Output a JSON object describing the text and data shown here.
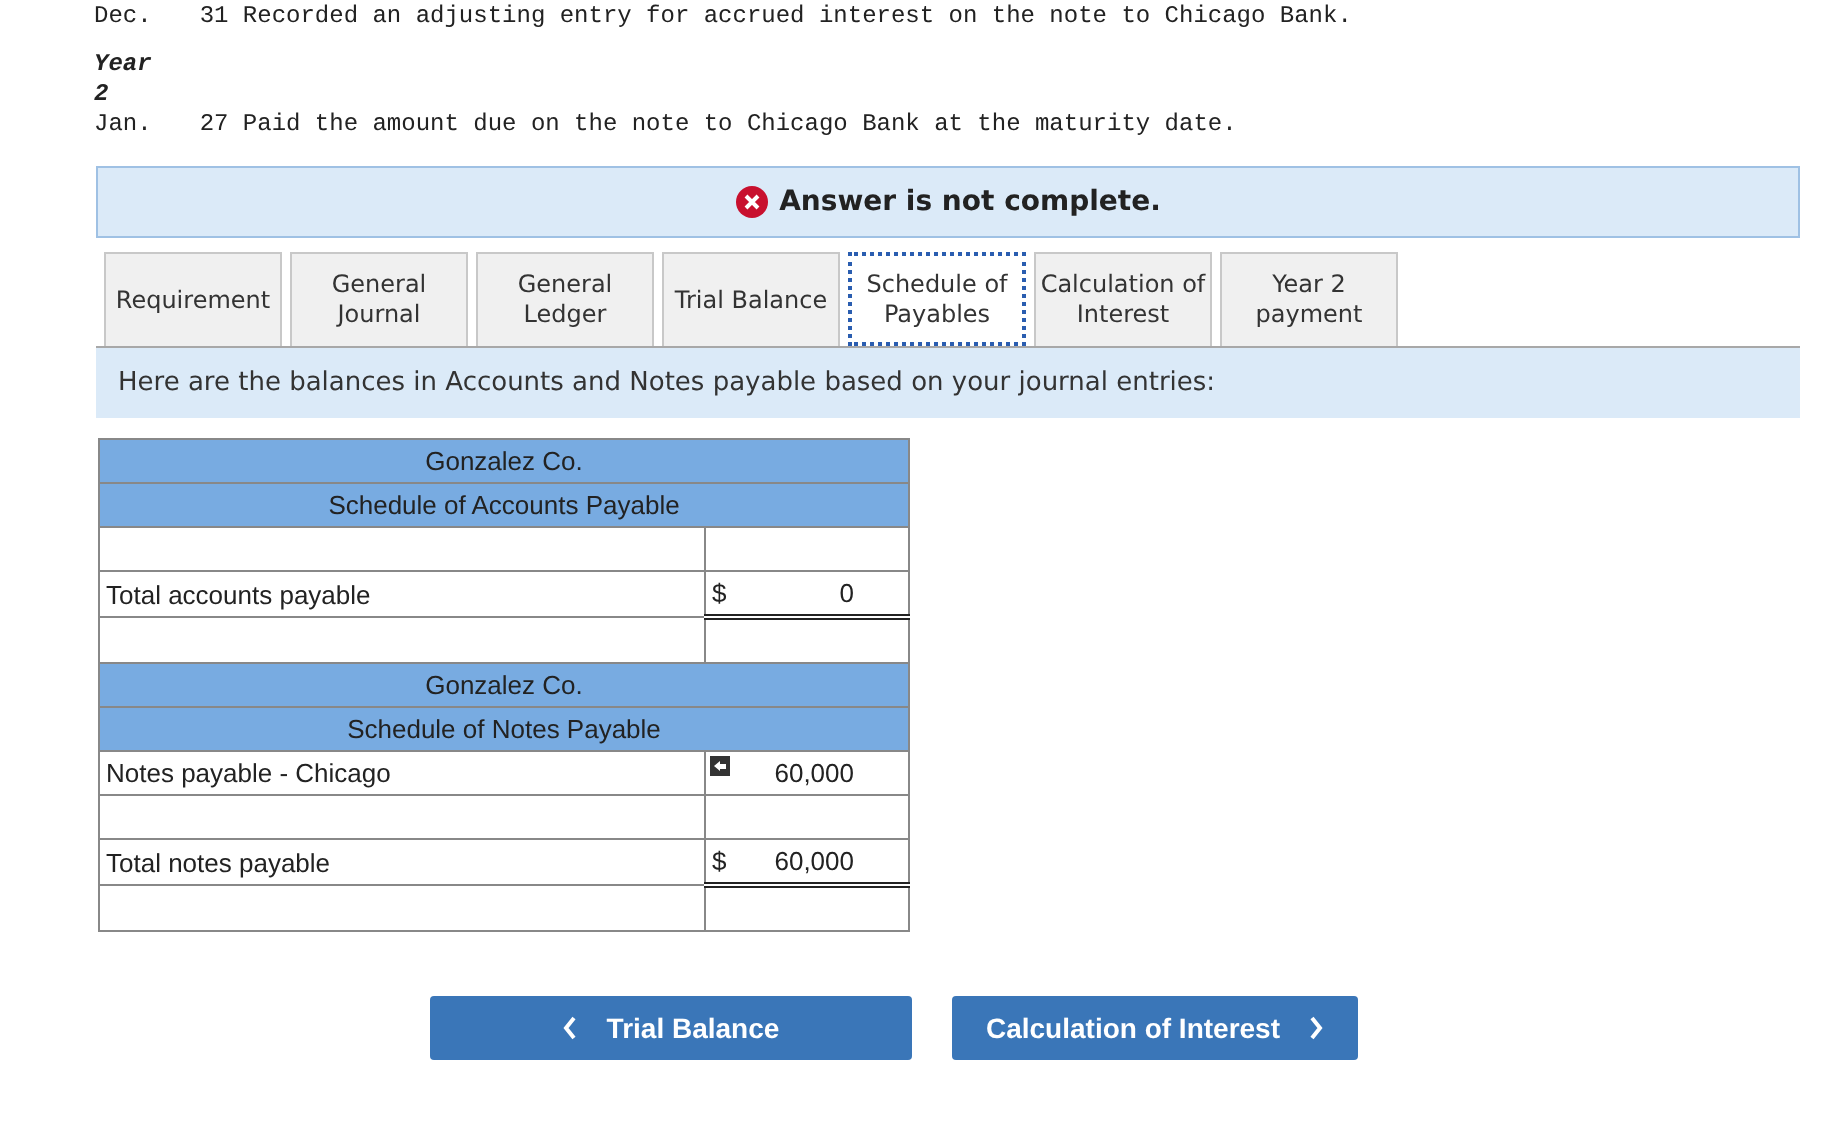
{
  "problem_lines": [
    {
      "month": "Dec.",
      "text": "31 Recorded an adjusting entry for accrued interest on the note to Chicago Bank."
    },
    {
      "year_label": "Year",
      "year_number": "2"
    },
    {
      "month": "Jan.",
      "text": "27 Paid the amount due on the note to Chicago Bank at the maturity date."
    }
  ],
  "status_banner": {
    "text": "Answer is not complete.",
    "complete": false
  },
  "tabs": [
    {
      "label": "Requirement",
      "selected": false
    },
    {
      "label": "General\nJournal",
      "selected": false
    },
    {
      "label": "General\nLedger",
      "selected": false
    },
    {
      "label": "Trial Balance",
      "selected": false
    },
    {
      "label": "Schedule of\nPayables",
      "selected": true
    },
    {
      "label": "Calculation of\nInterest",
      "selected": false
    },
    {
      "label": "Year 2\npayment",
      "selected": false
    }
  ],
  "instruction": "Here are the balances in Accounts and Notes payable based on your journal entries:",
  "schedule_rows": [
    {
      "kind": "title",
      "text": "Gonzalez Co."
    },
    {
      "kind": "title",
      "text": "Schedule of Accounts Payable"
    },
    {
      "kind": "blank"
    },
    {
      "kind": "total",
      "label": "Total accounts payable",
      "currency": "$",
      "amount": "0"
    },
    {
      "kind": "blank"
    },
    {
      "kind": "title",
      "text": "Gonzalez Co."
    },
    {
      "kind": "title",
      "text": "Schedule of Notes Payable"
    },
    {
      "kind": "line",
      "label": "Notes payable - Chicago",
      "amount": "60,000",
      "marker": true
    },
    {
      "kind": "blank"
    },
    {
      "kind": "total",
      "label": "Total notes payable",
      "currency": "$",
      "amount": "60,000"
    },
    {
      "kind": "blank"
    }
  ],
  "nav_buttons": {
    "previous": "Trial Balance",
    "next": "Calculation of Interest"
  }
}
